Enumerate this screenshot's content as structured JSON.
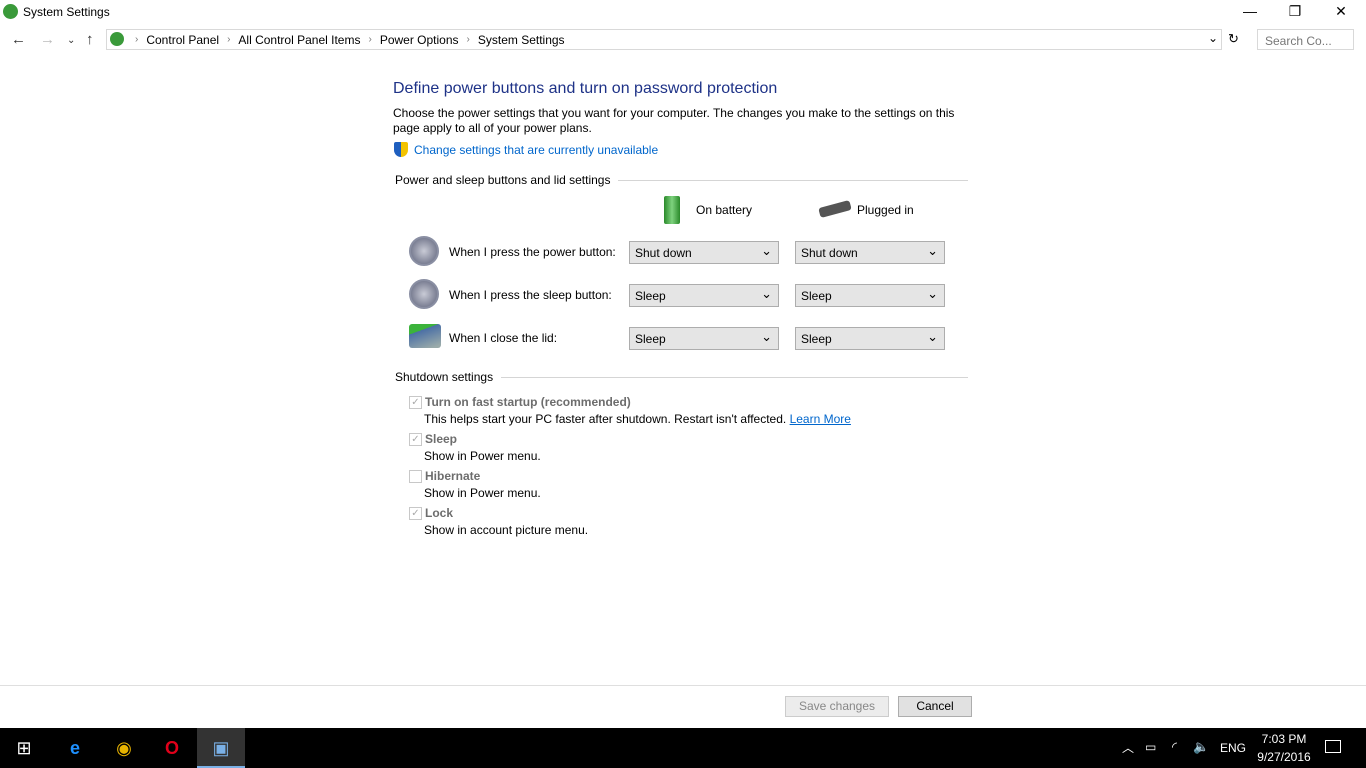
{
  "window": {
    "title": "System Settings"
  },
  "address": {
    "crumbs": [
      "Control Panel",
      "All Control Panel Items",
      "Power Options",
      "System Settings"
    ],
    "search_placeholder": "Search Co..."
  },
  "main": {
    "heading": "Define power buttons and turn on password protection",
    "description": "Choose the power settings that you want for your computer. The changes you make to the settings on this page apply to all of your power plans.",
    "change_link": "Change settings that are currently unavailable",
    "group1": "Power and sleep buttons and lid settings",
    "col_battery": "On battery",
    "col_plugged": "Plugged in",
    "rows": [
      {
        "label": "When I press the power button:",
        "battery": "Shut down",
        "plugged": "Shut down"
      },
      {
        "label": "When I press the sleep button:",
        "battery": "Sleep",
        "plugged": "Sleep"
      },
      {
        "label": "When I close the lid:",
        "battery": "Sleep",
        "plugged": "Sleep"
      }
    ],
    "group2": "Shutdown settings",
    "options": [
      {
        "label": "Turn on fast startup (recommended)",
        "desc": "This helps start your PC faster after shutdown. Restart isn't affected.",
        "checked": true
      },
      {
        "label": "Sleep",
        "desc": "Show in Power menu.",
        "checked": true
      },
      {
        "label": "Hibernate",
        "desc": "Show in Power menu.",
        "checked": false
      },
      {
        "label": "Lock",
        "desc": "Show in account picture menu.",
        "checked": true
      }
    ],
    "learn_more": "Learn More"
  },
  "footer": {
    "save": "Save changes",
    "cancel": "Cancel"
  },
  "taskbar": {
    "time": "7:03 PM",
    "date": "9/27/2016",
    "lang": "ENG"
  }
}
